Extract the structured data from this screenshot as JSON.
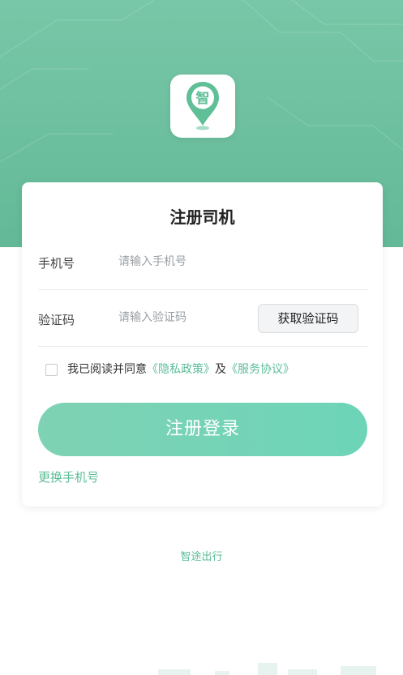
{
  "page": {
    "title": "注册司机"
  },
  "logo": {
    "char": "智"
  },
  "form": {
    "phone_label": "手机号",
    "phone_placeholder": "请输入手机号",
    "code_label": "验证码",
    "code_placeholder": "请输入验证码",
    "get_code_label": "获取验证码"
  },
  "agreement": {
    "prefix": "我已阅读并同意",
    "privacy": "《隐私政策》",
    "and": "及",
    "service": "《服务协议》",
    "checked": false
  },
  "submit_label": "注册登录",
  "change_phone_label": "更换手机号",
  "footer": {
    "app_name": "智途出行"
  },
  "colors": {
    "brand": "#66bb98",
    "accent_text": "#5bbd98"
  }
}
